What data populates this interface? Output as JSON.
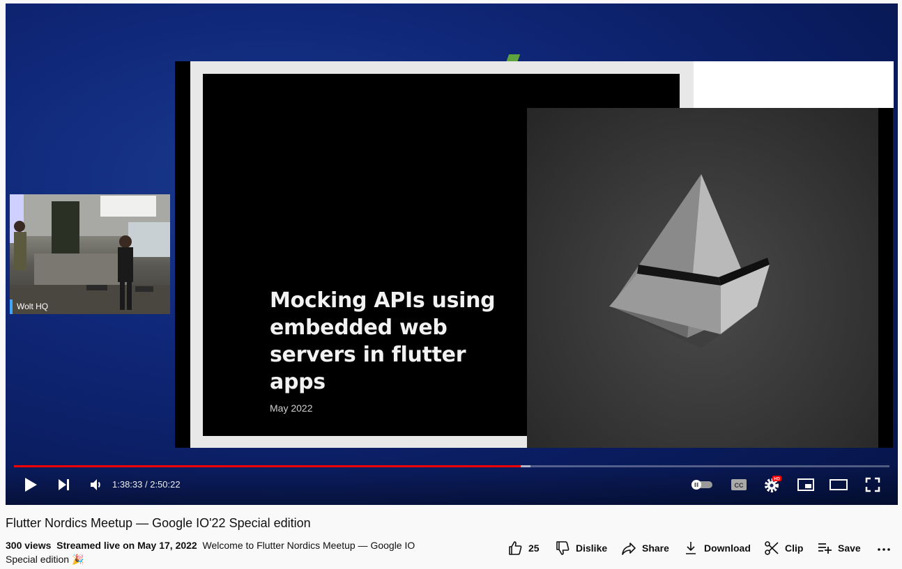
{
  "player": {
    "slide": {
      "title": "Mocking APIs using embedded web servers in flutter apps",
      "date": "May 2022"
    },
    "pip_label": "Wolt HQ",
    "time": "1:38:33 / 2:50:22",
    "progress": {
      "played": 0.5787,
      "loaded": 0.59
    }
  },
  "video": {
    "title": "Flutter Nordics Meetup — Google IO'22 Special edition",
    "views": "300 views",
    "streamed": "Streamed live on May 17, 2022",
    "description": "Welcome to Flutter Nordics Meetup — Google IO Special edition 🎉"
  },
  "actions": {
    "like_count": "25",
    "dislike": "Dislike",
    "share": "Share",
    "download": "Download",
    "clip": "Clip",
    "save": "Save"
  },
  "icons": {
    "play": "play-icon",
    "next": "next-icon",
    "volume": "volume-icon",
    "autoplay": "autoplay-toggle-icon",
    "cc": "cc-icon",
    "settings": "gear-icon",
    "miniplayer": "miniplayer-icon",
    "theater": "theater-icon",
    "fullscreen": "fullscreen-icon"
  }
}
